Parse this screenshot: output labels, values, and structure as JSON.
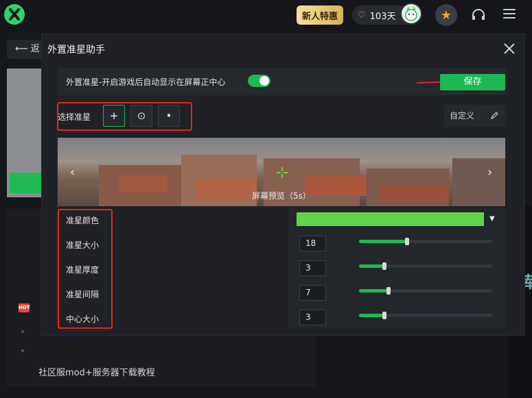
{
  "topbar": {
    "promo_label": "新人特惠",
    "vip_days": "103天"
  },
  "background": {
    "back_label": "返",
    "hot_badge": "HOT",
    "link_text": "社区服mod+服务器下载教程",
    "side_char": "库"
  },
  "dialog": {
    "title": "外置准星助手",
    "auto_label": "外置准星-开启游戏后自动显示在屏幕正中心",
    "auto_enabled": true,
    "save_label": "保存",
    "select_label": "选择准星",
    "crosshair_options": [
      "+",
      "⊙",
      "•"
    ],
    "custom_label": "自定义",
    "preview_text": "屏幕预览（5s）",
    "settings": [
      {
        "label": "准星颜色",
        "color": "#5ed548"
      },
      {
        "label": "准星大小",
        "value": "18",
        "fraction": 0.36
      },
      {
        "label": "准星厚度",
        "value": "3",
        "fraction": 0.19
      },
      {
        "label": "准星间隔",
        "value": "7",
        "fraction": 0.22
      },
      {
        "label": "中心大小",
        "value": "3",
        "fraction": 0.19
      }
    ]
  },
  "colors": {
    "accent": "#1db954",
    "highlight": "#e2261e"
  }
}
